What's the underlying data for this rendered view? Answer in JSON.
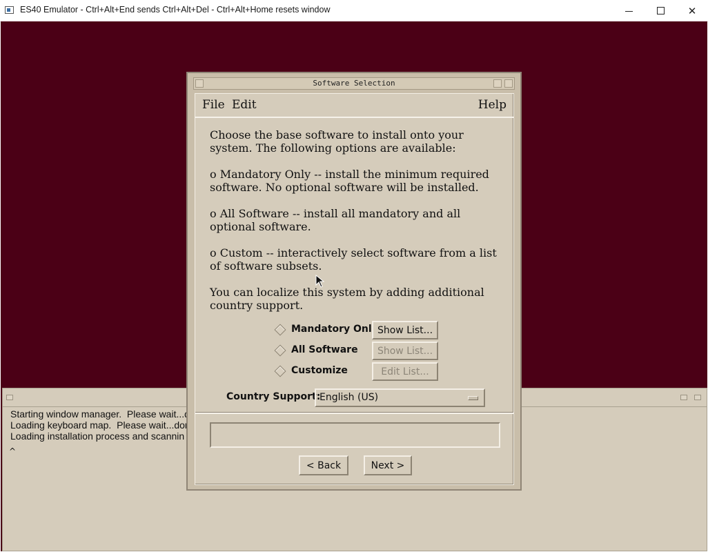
{
  "host": {
    "title": "ES40 Emulator - Ctrl+Alt+End sends Ctrl+Alt+Del - Ctrl+Alt+Home resets window",
    "controls": [
      "minimize-icon",
      "maximize-icon",
      "close-icon"
    ]
  },
  "console": {
    "lines": [
      "Starting window manager.  Please wait...d",
      "Loading keyboard map.  Please wait...dor",
      "Loading installation process and scannin"
    ],
    "caret": "^"
  },
  "dialog": {
    "title": "Software Selection",
    "menu": {
      "file": "File",
      "edit": "Edit",
      "help": "Help"
    },
    "intro": "Choose the base software to install onto your system. The following options are available:",
    "opt_mandatory_desc": "o  Mandatory Only -- install the minimum required software.  No optional software will be installed.",
    "opt_all_desc": "o  All Software -- install all mandatory and all optional software.",
    "opt_custom_desc": "o  Custom -- interactively select software from a list of software subsets.",
    "localize": "You can localize this system by adding additional country support.",
    "options": [
      {
        "label": "Mandatory Only",
        "button": "Show List...",
        "enabled": true
      },
      {
        "label": "All Software",
        "button": "Show List...",
        "enabled": false
      },
      {
        "label": "Customize",
        "button": "Edit List...",
        "enabled": false
      }
    ],
    "country_label": "Country Support:",
    "country_value": "English (US)",
    "back": "< Back",
    "next": "Next >"
  },
  "colors": {
    "screen_bg": "#4b0016",
    "panel": "#d5ccbb"
  }
}
